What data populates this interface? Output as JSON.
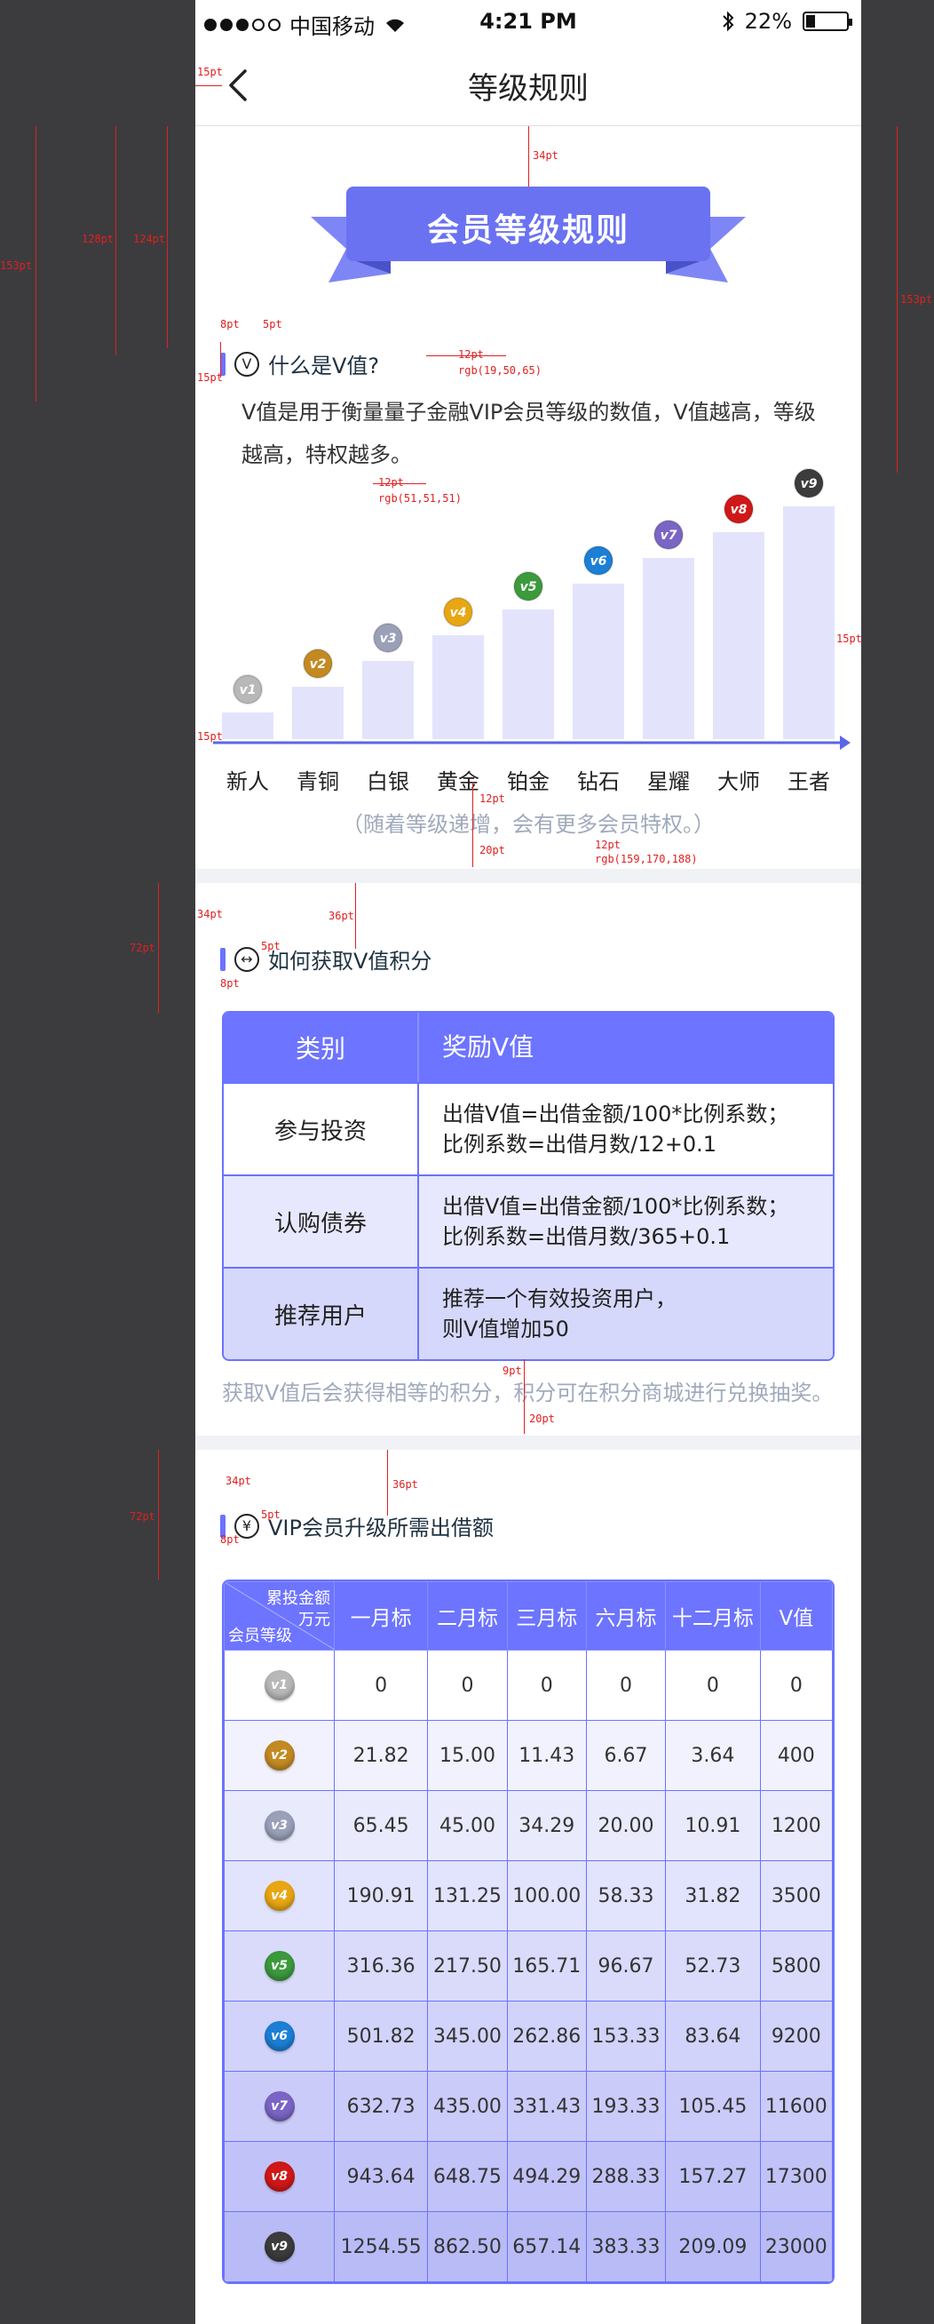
{
  "status_bar": {
    "carrier": "中国移动",
    "time": "4:21 PM",
    "battery": "22%"
  },
  "nav": {
    "title": "等级规则"
  },
  "banner": {
    "title": "会员等级规则"
  },
  "what_is": {
    "heading": "什么是V值?",
    "icon_letter": "V",
    "description": "V值是用于衡量量子金融VIP会员等级的数值，V值越高，等级越高，特权越多。"
  },
  "levels": {
    "badges": [
      "v1",
      "v2",
      "v3",
      "v4",
      "v5",
      "v6",
      "v7",
      "v8",
      "v9"
    ],
    "names": [
      "新人",
      "青铜",
      "白银",
      "黄金",
      "铂金",
      "钻石",
      "星耀",
      "大师",
      "王者"
    ],
    "badge_colors": [
      "#b8b8b8",
      "#c48a22",
      "#9aa0b8",
      "#e8a612",
      "#3c9a3c",
      "#1b7fd6",
      "#7a65c5",
      "#d01818",
      "#3c3c3c"
    ],
    "bar_fill": "#e3e4fb",
    "axis_color": "#5a66e8",
    "note": "（随着等级递增，会有更多会员特权。）"
  },
  "how_to_get": {
    "heading": "如何获取V值积分",
    "header": [
      "类别",
      "奖励V值"
    ],
    "rows": [
      {
        "category": "参与投资",
        "line1": "出借V值=出借金额/100*比例系数；",
        "line2": "比例系数=出借月数/12+0.1"
      },
      {
        "category": "认购债券",
        "line1": "出借V值=出借金额/100*比例系数；",
        "line2": "比例系数=出借月数/365+0.1"
      },
      {
        "category": "推荐用户",
        "line1": "推荐一个有效投资用户，",
        "line2": "则V值增加50"
      }
    ],
    "footnote": "获取V值后会获得相等的积分，积分可在积分商城进行兑换抽奖。"
  },
  "upgrade": {
    "heading": "VIP会员升级所需出借额",
    "icon_letter": "¥",
    "corner_top": "累投金额",
    "corner_unit": "万元",
    "corner_bottom": "会员等级",
    "columns": [
      "一月标",
      "二月标",
      "三月标",
      "六月标",
      "十二月标",
      "V值"
    ],
    "rows": [
      [
        "0",
        "0",
        "0",
        "0",
        "0",
        "0"
      ],
      [
        "21.82",
        "15.00",
        "11.43",
        "6.67",
        "3.64",
        "400"
      ],
      [
        "65.45",
        "45.00",
        "34.29",
        "20.00",
        "10.91",
        "1200"
      ],
      [
        "190.91",
        "131.25",
        "100.00",
        "58.33",
        "31.82",
        "3500"
      ],
      [
        "316.36",
        "217.50",
        "165.71",
        "96.67",
        "52.73",
        "5800"
      ],
      [
        "501.82",
        "345.00",
        "262.86",
        "153.33",
        "83.64",
        "9200"
      ],
      [
        "632.73",
        "435.00",
        "331.43",
        "193.33",
        "105.45",
        "11600"
      ],
      [
        "943.64",
        "648.75",
        "494.29",
        "288.33",
        "157.27",
        "17300"
      ],
      [
        "1254.55",
        "862.50",
        "657.14",
        "383.33",
        "209.09",
        "23000"
      ]
    ],
    "row_bg": [
      "#ffffff",
      "#f2f2fe",
      "#eaeafd",
      "#e2e3fc",
      "#dadbfb",
      "#d2d3fa",
      "#cacbf9",
      "#c1c3f8",
      "#b9bbf7"
    ]
  },
  "annotations": {
    "a15pt_1": "15pt",
    "a34pt_1": "34pt",
    "a153pt_l": "153pt",
    "a128pt": "128pt",
    "a124pt": "124pt",
    "a153pt_r": "153pt",
    "a8pt_1": "8pt",
    "a5pt_1": "5pt",
    "a15pt_2": "15pt",
    "a12pt_1": "12pt",
    "rgb_1": "rgb(19,50,65)",
    "a12pt_2": "12pt",
    "rgb_2": "rgb(51,51,51)",
    "a15pt_3": "15pt",
    "a15pt_4": "15pt",
    "a12pt_3": "12pt",
    "a20pt_1": "20pt",
    "a12pt_4": "12pt",
    "rgb_3": "rgb(159,170,188)",
    "a34pt_2": "34pt",
    "a36pt_1": "36pt",
    "a72pt_1": "72pt",
    "a5pt_2": "5pt",
    "a8pt_2": "8pt",
    "a9pt": "9pt",
    "a20pt_2": "20pt",
    "a34pt_3": "34pt",
    "a36pt_2": "36pt",
    "a72pt_2": "72pt",
    "a5pt_3": "5pt",
    "a8pt_3": "8pt"
  }
}
